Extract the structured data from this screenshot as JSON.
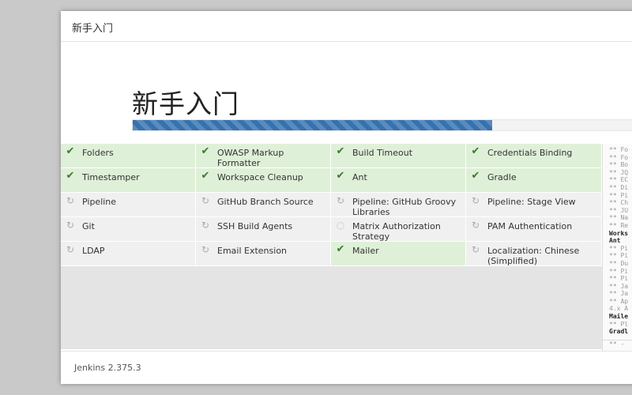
{
  "dialog": {
    "title": "新手入门"
  },
  "hero": {
    "title": "新手入门",
    "progress_percent": 70
  },
  "plugins": [
    {
      "label": "Folders",
      "status": "done",
      "icon": "check-icon"
    },
    {
      "label": "OWASP Markup Formatter",
      "status": "done",
      "icon": "check-icon"
    },
    {
      "label": "Build Timeout",
      "status": "done",
      "icon": "check-icon"
    },
    {
      "label": "Credentials Binding",
      "status": "done",
      "icon": "check-icon"
    },
    {
      "label": "Timestamper",
      "status": "done",
      "icon": "check-icon"
    },
    {
      "label": "Workspace Cleanup",
      "status": "done",
      "icon": "check-icon"
    },
    {
      "label": "Ant",
      "status": "done",
      "icon": "check-icon"
    },
    {
      "label": "Gradle",
      "status": "done",
      "icon": "check-icon"
    },
    {
      "label": "Pipeline",
      "status": "installing",
      "icon": "refresh-icon"
    },
    {
      "label": "GitHub Branch Source",
      "status": "installing",
      "icon": "refresh-icon"
    },
    {
      "label": "Pipeline: GitHub Groovy Libraries",
      "status": "installing",
      "icon": "refresh-icon"
    },
    {
      "label": "Pipeline: Stage View",
      "status": "installing",
      "icon": "refresh-icon"
    },
    {
      "label": "Git",
      "status": "installing",
      "icon": "refresh-icon"
    },
    {
      "label": "SSH Build Agents",
      "status": "installing",
      "icon": "refresh-icon"
    },
    {
      "label": "Matrix Authorization Strategy",
      "status": "pending",
      "icon": "pending-circle-icon"
    },
    {
      "label": "PAM Authentication",
      "status": "installing",
      "icon": "refresh-icon"
    },
    {
      "label": "LDAP",
      "status": "installing",
      "icon": "refresh-icon"
    },
    {
      "label": "Email Extension",
      "status": "installing",
      "icon": "refresh-icon"
    },
    {
      "label": "Mailer",
      "status": "done",
      "icon": "check-icon"
    },
    {
      "label": "Localization: Chinese (Simplified)",
      "status": "installing",
      "icon": "refresh-icon"
    }
  ],
  "log": {
    "lines": [
      {
        "text": "** Fo",
        "bold": false
      },
      {
        "text": "** Fo",
        "bold": false
      },
      {
        "text": "** Bo",
        "bold": false
      },
      {
        "text": "** JQ",
        "bold": false
      },
      {
        "text": "** EC",
        "bold": false
      },
      {
        "text": "** Di",
        "bold": false
      },
      {
        "text": "** Pi",
        "bold": false
      },
      {
        "text": "** Ch",
        "bold": false
      },
      {
        "text": "** JU",
        "bold": false
      },
      {
        "text": "** Na",
        "bold": false
      },
      {
        "text": "** Re",
        "bold": false
      },
      {
        "text": "Works",
        "bold": true
      },
      {
        "text": "Ant",
        "bold": true
      },
      {
        "text": "** Pi",
        "bold": false
      },
      {
        "text": "** Pi",
        "bold": false
      },
      {
        "text": "** Du",
        "bold": false
      },
      {
        "text": "** Pi",
        "bold": false
      },
      {
        "text": "** Pi",
        "bold": false
      },
      {
        "text": "** Ja",
        "bold": false
      },
      {
        "text": "** Ja",
        "bold": false
      },
      {
        "text": "** Ap",
        "bold": false
      },
      {
        "text": "4.x A",
        "bold": false
      },
      {
        "text": "Maile",
        "bold": true
      },
      {
        "text": "** Pl",
        "bold": false
      },
      {
        "text": "Gradl",
        "bold": true
      }
    ],
    "tail": "** -"
  },
  "footer": {
    "version": "Jenkins 2.375.3"
  }
}
